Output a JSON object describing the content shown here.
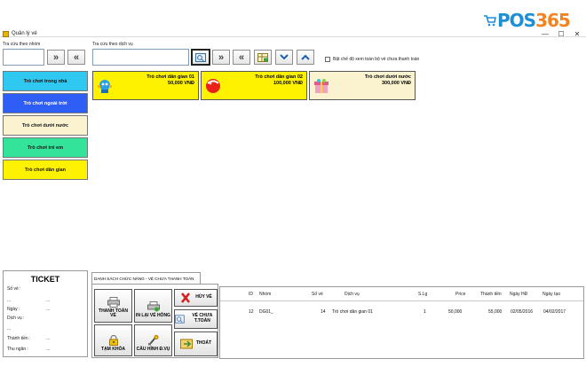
{
  "window": {
    "title": "Quản lý vé",
    "min": "—",
    "max": "☐",
    "close": "✕"
  },
  "brand": {
    "prefix": "POS",
    "suffix": "365",
    "color_primary": "#1d8fd6",
    "color_accent": "#f4821f"
  },
  "group_search": {
    "label": "Tra cứu theo nhóm",
    "value": ""
  },
  "service_search": {
    "label": "Tra cứu theo dịch vụ",
    "value": ""
  },
  "nav": {
    "next": "»",
    "prev": "«",
    "down": "⌄",
    "up": "⌃"
  },
  "checkbox": {
    "label": "Bật chế độ xem toàn bộ vé chưa thanh toán",
    "checked": false
  },
  "groups": [
    {
      "label": "Trò chơi trong nhà",
      "color": "#2ec8f0"
    },
    {
      "label": "Trò chơi ngoài trời",
      "color": "#2f5ef7"
    },
    {
      "label": "Trò chơi dưới nước",
      "color": "#fbf3cf"
    },
    {
      "label": "Trò chơi trẻ em",
      "color": "#33e39a"
    },
    {
      "label": "Trò chơi dân gian",
      "color": "#fff200"
    }
  ],
  "services": [
    {
      "name": "Trò chơi dân gian 01",
      "price": "50,000 VNĐ",
      "color": "#fff200",
      "icon": "robot-icon"
    },
    {
      "name": "Trò chơi dân gian 02",
      "price": "100,000 VNĐ",
      "color": "#fff200",
      "icon": "ball-icon"
    },
    {
      "name": "Trò chơi dưới nước",
      "price": "300,000 VNĐ",
      "color": "#fbf3cf",
      "icon": "gift-icon"
    }
  ],
  "ticket": {
    "title": "TICKET",
    "fields": [
      {
        "label": "Số vé :",
        "value": ""
      },
      {
        "label": "...",
        "value": "..."
      },
      {
        "label": "Ngày :",
        "value": "..."
      },
      {
        "label": "Dịch vụ :",
        "value": ""
      },
      {
        "label": "...",
        "value": ""
      },
      {
        "label": "Thành tiền :",
        "value": "..."
      },
      {
        "label": "Thu ngân :",
        "value": "..."
      }
    ]
  },
  "function_tab": {
    "label": "DANH SÁCH CHỨC NĂNG - VÉ CHƯA THANH TOÁN"
  },
  "functions": {
    "pay": "THANH TOÁN VÉ",
    "reprint": "IN LẠI VÉ HỎNG",
    "cancel": "HỦY VÉ",
    "unpaid": "VÉ CHƯA T.TOÁN",
    "lock": "TẠM KHÓA",
    "config": "CẤU HÌNH Đ.VỤ",
    "exit": "THOÁT"
  },
  "grid": {
    "columns": [
      "ID",
      "Nhóm",
      "Số vé",
      "Dịch vụ",
      "S.Lg",
      "Price",
      "Thành tiền",
      "Ngày HĐ",
      "Ngày tạo"
    ],
    "rows": [
      [
        "12",
        "DG01_",
        "14",
        "Trò chơi dân gian 01",
        "1",
        "50,000",
        "55,000",
        "02/05/2016",
        "04/02/2017"
      ]
    ]
  }
}
